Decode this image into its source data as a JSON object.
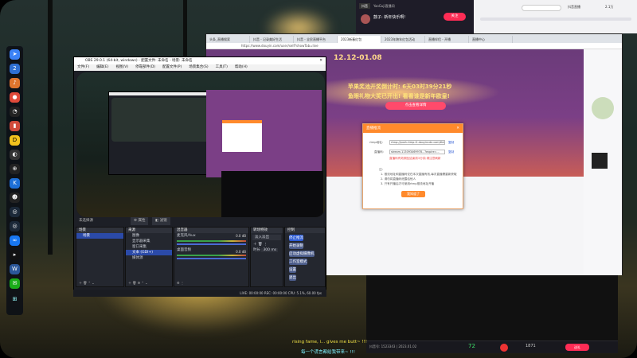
{
  "obs": {
    "title": "OBS 29.0.1 (64-bit, windows) - 配置文件: 未命名 - 场景: 未命名",
    "menu": [
      "文件(F)",
      "编辑(E)",
      "视图(V)",
      "停靠部件(D)",
      "配置文件(P)",
      "场景集合(S)",
      "工具(T)",
      "帮助(H)"
    ],
    "scene_bar": {
      "label": "未选择源",
      "props": "属性",
      "filters": "滤镜"
    },
    "scenes": {
      "header": "场景",
      "items": [
        "场景"
      ]
    },
    "sources": {
      "header": "来源",
      "items": [
        "图像",
        "显示器采集",
        "窗口采集",
        "文本 (GDI+)",
        "媒体源"
      ]
    },
    "mixer": {
      "header": "混音器",
      "tracks": [
        {
          "name": "麦克风/Aux",
          "level": "0.0 dB"
        },
        {
          "name": "桌面音频",
          "level": "0.0 dB"
        }
      ]
    },
    "transitions": {
      "header": "转场特效",
      "type": "淡入淡出",
      "duration_label": "时长",
      "duration": "300 ms"
    },
    "controls": {
      "header": "控制",
      "buttons": [
        "停止推流",
        "开始录制",
        "启动虚拟摄像机",
        "工作室模式",
        "设置",
        "退出"
      ]
    },
    "status": "LIVE: 00:00:00   REC: 00:00:00   CPU: 5.1%, 60.00 fps"
  },
  "browser": {
    "tabs": [
      "头条_直播搜索",
      "抖音 - 记录美好生活",
      "抖音 - 全民直播平台",
      "2023新春红包",
      "2023年跨年红包活动",
      "直播伴侣 - 开播",
      "直播中心"
    ],
    "url": "https://www.douyin.com/user/self?showTab=live",
    "headline": "苹果奖池开奖倒计时: 6天03时39分21秒",
    "subline": "鱼眼礼物大奖已开出! 看看谁是新年欧皇!",
    "cta": "点击查看详情",
    "date": "12.12-01.08"
  },
  "dialog": {
    "title": "直播推流",
    "rtmp_label": "rtmp地址:",
    "rtmp_value": "rtmp://push-rtmp-l1.douyincdn.com/third",
    "key_label": "直播码:",
    "key_value": "stream-113093469978...?expire=...",
    "copy": "复制",
    "warn": "直播码有效期至结束前3分钟,请注意刷新",
    "notes_title": "注:",
    "notes": [
      "1. 推流地址和直播码仅在本次直播有效,每次直播需重新获取",
      "2. 请勿将直播码泄露给他人",
      "3. 只有开播后才可使用rtmp推流地址开播"
    ],
    "confirm": "我知道了"
  },
  "douyin": {
    "app": "YaoGuji直播间",
    "streamer": "鼓子: 新年快乐啊!",
    "follow": "关注",
    "count": "2.1万",
    "right_title": "抖音直播"
  },
  "bottom": {
    "room": "抖音号: 1523343 | 2023.01.02",
    "likes": "72",
    "viewers": "1871",
    "gift_btn": "送礼"
  },
  "subtitles": {
    "line1": "rising fame, i... gives me butt~ !!!",
    "line2": "每一个谎言都给我带来~ !!!"
  },
  "taskbar_icons": [
    "rocket-icon",
    "edge-icon",
    "folder-icon",
    "notion-icon",
    "app-icon",
    "app-icon",
    "k-icon",
    "qq-icon",
    "steam-icon",
    "meta-icon",
    "terminal-icon",
    "word-icon",
    "wechat-icon"
  ],
  "colors": {
    "obs_accent": "#2d5bd4",
    "dialog_accent": "#ff8a2c",
    "subtitle_yellow": "#f2e246",
    "subtitle_cyan": "#7ff0ff"
  }
}
